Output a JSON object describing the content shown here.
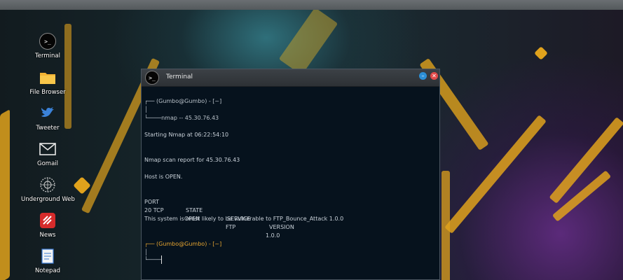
{
  "desktop": {
    "icons": [
      {
        "label": "Terminal",
        "icon": "terminal-icon"
      },
      {
        "label": "File Browser",
        "icon": "folder-icon"
      },
      {
        "label": "Tweeter",
        "icon": "bird-icon"
      },
      {
        "label": "Gomail",
        "icon": "mail-icon"
      },
      {
        "label": "Underground Web",
        "icon": "globe-icon"
      },
      {
        "label": "News",
        "icon": "news-icon"
      },
      {
        "label": "Notepad",
        "icon": "notepad-icon"
      }
    ]
  },
  "window": {
    "title": "Terminal",
    "icon": ">_"
  },
  "terminal": {
    "prompt1": "(Gumbo@Gumbo) - [~]",
    "command": "nmap -- 45.30.76.43",
    "starting": "Starting Nmap at 06:22:54:10",
    "report": "Nmap scan report for 45.30.76.43",
    "host": "Host is OPEN.",
    "table": {
      "headers": [
        "PORT",
        "STATE",
        "SERVICE",
        "VERSION"
      ],
      "row": [
        "20 TCP",
        "OPEN",
        "FTP",
        "1.0.0"
      ]
    },
    "vuln": "This system is most likely to be vulnerable to FTP_Bounce_Attack 1.0.0",
    "prompt2": "(Gumbo@Gumbo) - [~]"
  },
  "colors": {
    "terminal_bg": "#06121d",
    "accent_orange": "#e7a530",
    "minimize": "#2c8fd6",
    "close": "#e24a4a"
  }
}
